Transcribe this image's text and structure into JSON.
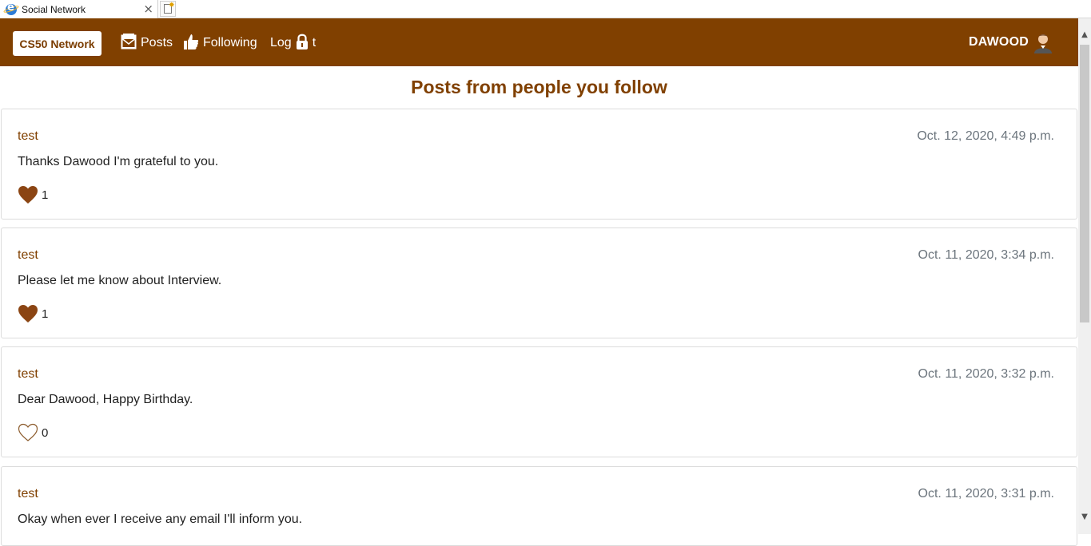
{
  "browser": {
    "tab_title": "Social Network",
    "tab_close": "×"
  },
  "navbar": {
    "brand": "CS50 Network",
    "links": [
      {
        "label": "Posts",
        "icon": "mailbox-icon"
      },
      {
        "label": "Following",
        "icon": "thumbs-up-icon"
      },
      {
        "label_pre": "Log",
        "label_post": "t",
        "icon": "lock-icon"
      }
    ],
    "username": "DAWOOD",
    "avatar_icon": "user-avatar-icon"
  },
  "page": {
    "title": "Posts from people you follow"
  },
  "posts": [
    {
      "author": "test",
      "timestamp": "Oct. 12, 2020, 4:49 p.m.",
      "body": "Thanks Dawood I'm grateful to you.",
      "likes": "1",
      "liked": true
    },
    {
      "author": "test",
      "timestamp": "Oct. 11, 2020, 3:34 p.m.",
      "body": "Please let me know about Interview.",
      "likes": "1",
      "liked": true
    },
    {
      "author": "test",
      "timestamp": "Oct. 11, 2020, 3:32 p.m.",
      "body": "Dear Dawood, Happy Birthday.",
      "likes": "0",
      "liked": false
    },
    {
      "author": "test",
      "timestamp": "Oct. 11, 2020, 3:31 p.m.",
      "body": "Okay when ever I receive any email I'll inform you.",
      "likes": "",
      "liked": false
    }
  ],
  "colors": {
    "brand": "#804000",
    "heart_filled": "#8b4513",
    "muted": "#6c757d"
  }
}
